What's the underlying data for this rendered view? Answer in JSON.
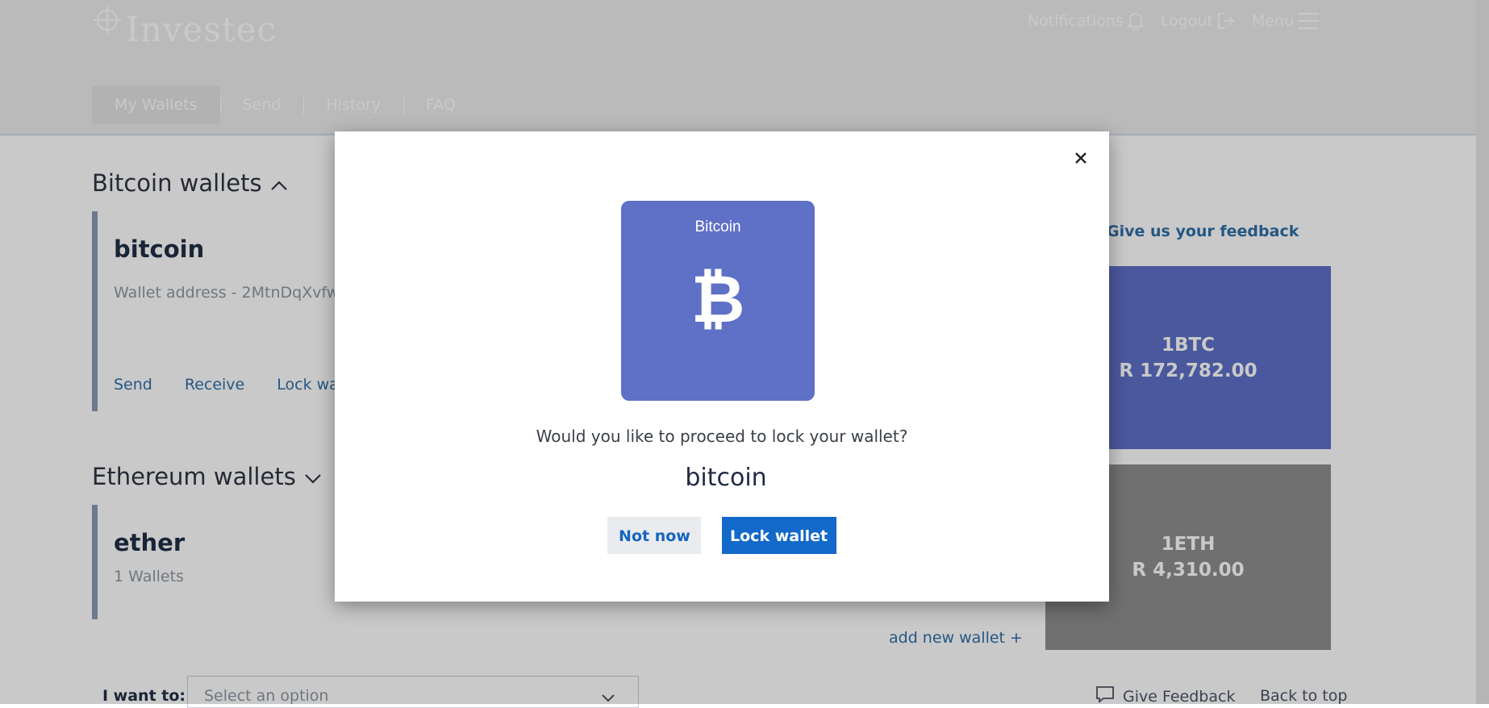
{
  "header": {
    "logo_text": "Investec",
    "top_links": {
      "notifications": "Notifications",
      "logout": "Logout",
      "menu": "Menu"
    },
    "nav": [
      "My Wallets",
      "Send",
      "History",
      "FAQ"
    ]
  },
  "main": {
    "bitcoin_section_title": "Bitcoin wallets",
    "bitcoin_card": {
      "name": "bitcoin",
      "address": "Wallet address - 2MtnDqXvfw",
      "actions": [
        "Send",
        "Receive",
        "Lock wal"
      ]
    },
    "ethereum_section_title": "Ethereum wallets",
    "ethereum_card": {
      "name": "ether",
      "count": "1 Wallets"
    },
    "add_wallet": "add new wallet +",
    "feedback_link": "Give us your feedback",
    "tiles": {
      "btc_amount": "1BTC",
      "btc_value": "R 172,782.00",
      "eth_amount": "1ETH",
      "eth_value": "R 4,310.00"
    }
  },
  "footer": {
    "want_label": "I want to:",
    "select_placeholder": "Select an option",
    "give_feedback": "Give Feedback",
    "back_to_top": "Back to top"
  },
  "modal": {
    "coin_name": "Bitcoin",
    "coin_symbol": "₿",
    "question": "Would you like to proceed to lock your wallet?",
    "wallet_name": "bitcoin",
    "cancel_label": "Not now",
    "confirm_label": "Lock wallet"
  },
  "colors": {
    "accent": "#1269c9",
    "coin_card": "#5f70c7"
  }
}
